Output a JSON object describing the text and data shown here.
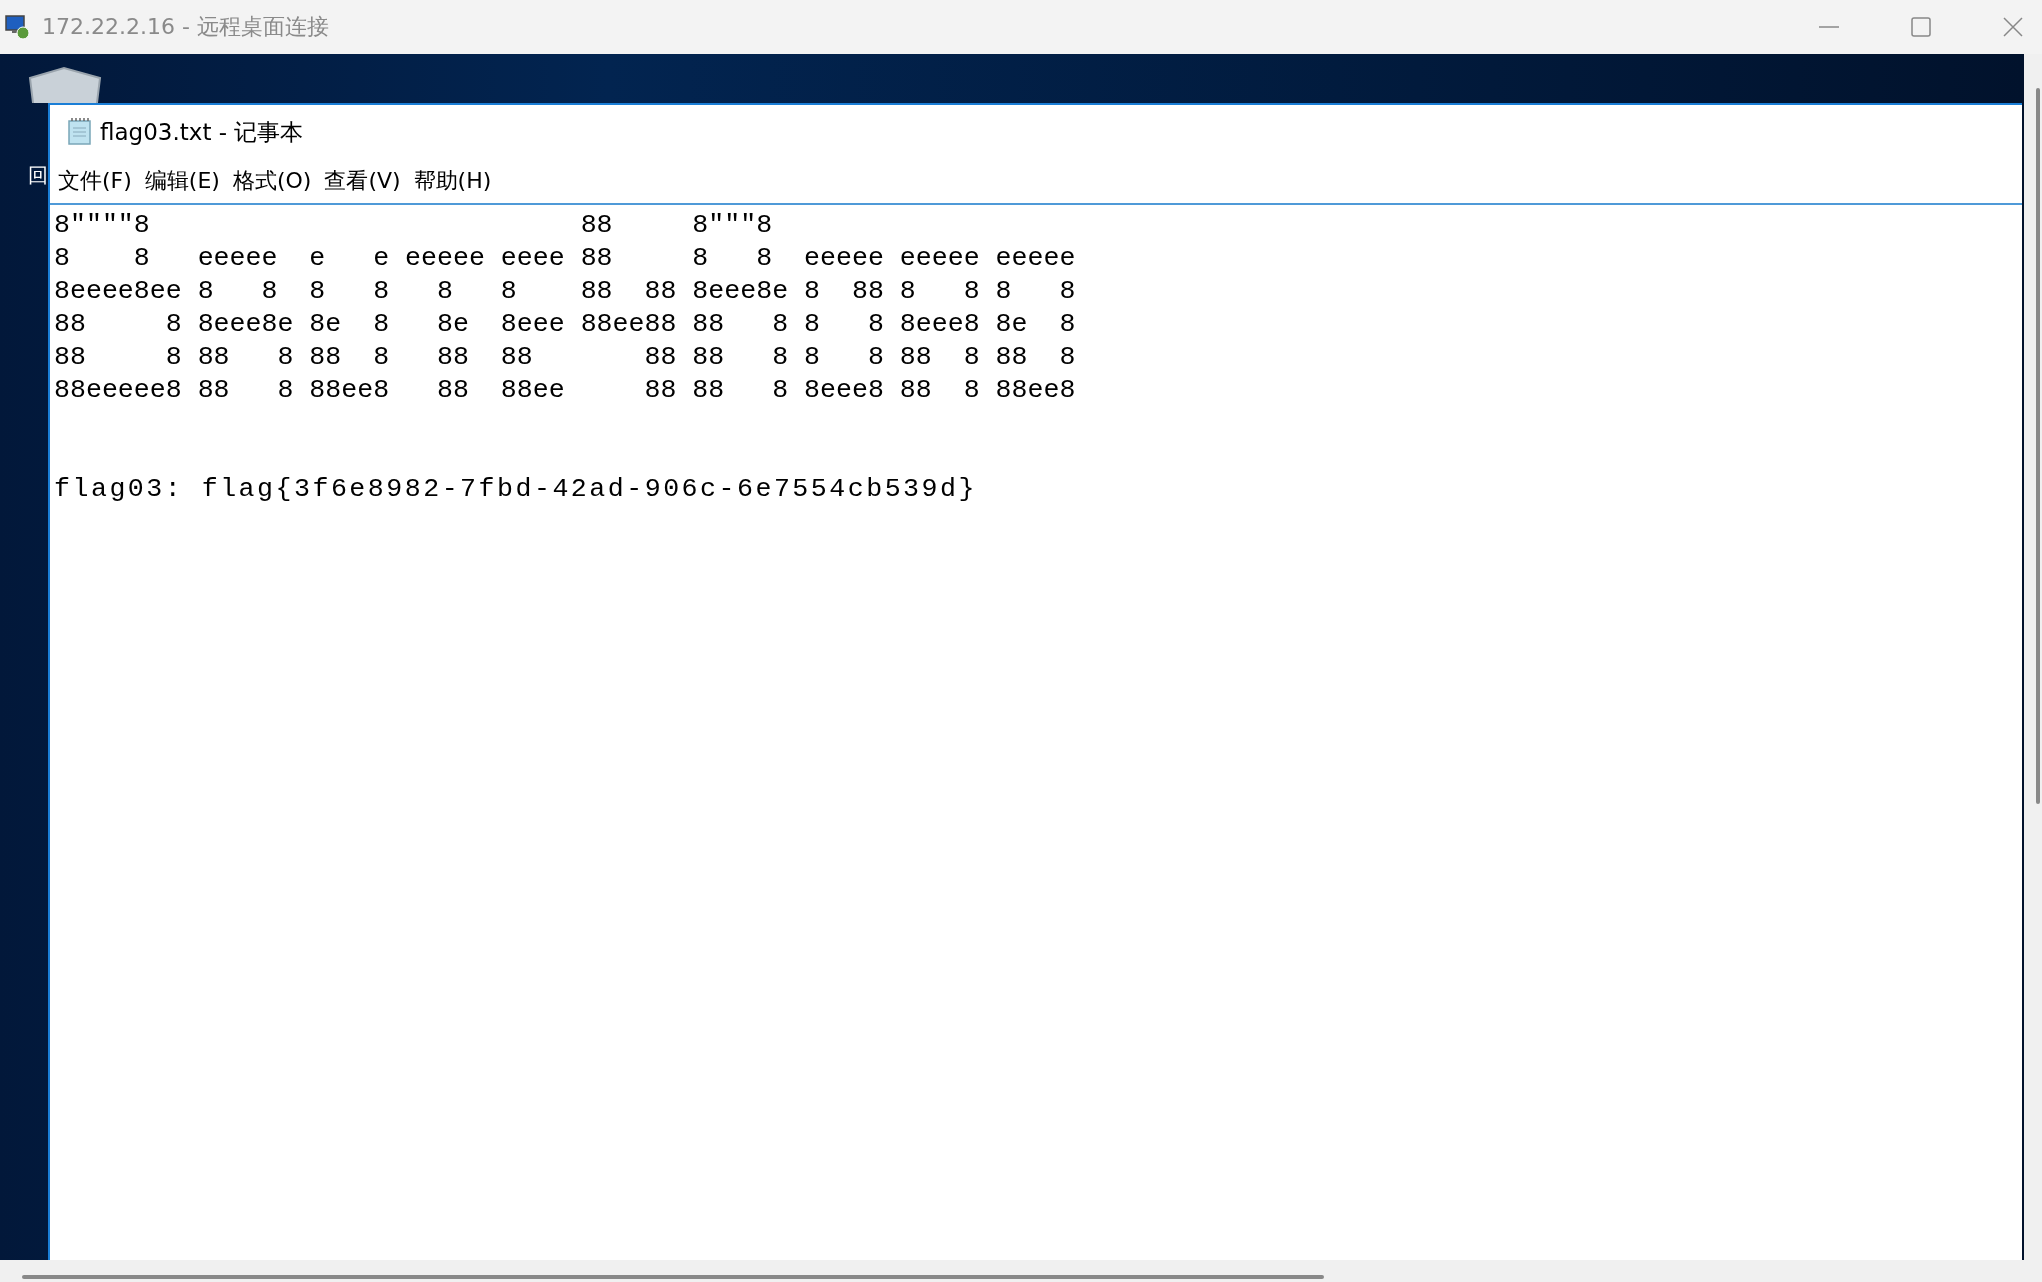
{
  "window": {
    "title": "172.22.2.16 - 远程桌面连接"
  },
  "desktop": {
    "icon_label": "回"
  },
  "notepad": {
    "title": "flag03.txt - 记事本",
    "menu": [
      "文件(F)",
      "编辑(E)",
      "格式(O)",
      "查看(V)",
      "帮助(H)"
    ],
    "ascii_art": [
      "8\"\"\"\"8                           88     8\"\"\"8",
      "8    8   eeeee  e   e eeeee eeee 88     8   8  eeeee eeeee eeeee",
      "8eeee8ee 8   8  8   8   8   8    88  88 8eee8e 8  88 8   8 8   8",
      "88     8 8eee8e 8e  8   8e  8eee 88ee88 88   8 8   8 8eee8 8e  8",
      "88     8 88   8 88  8   88  88       88 88   8 8   8 88  8 88  8",
      "88eeeee8 88   8 88ee8   88  88ee     88 88   8 8eee8 88  8 88ee8"
    ],
    "flag_line": "flag03: flag{3f6e8982-7fbd-42ad-906c-6e7554cb539d}"
  }
}
